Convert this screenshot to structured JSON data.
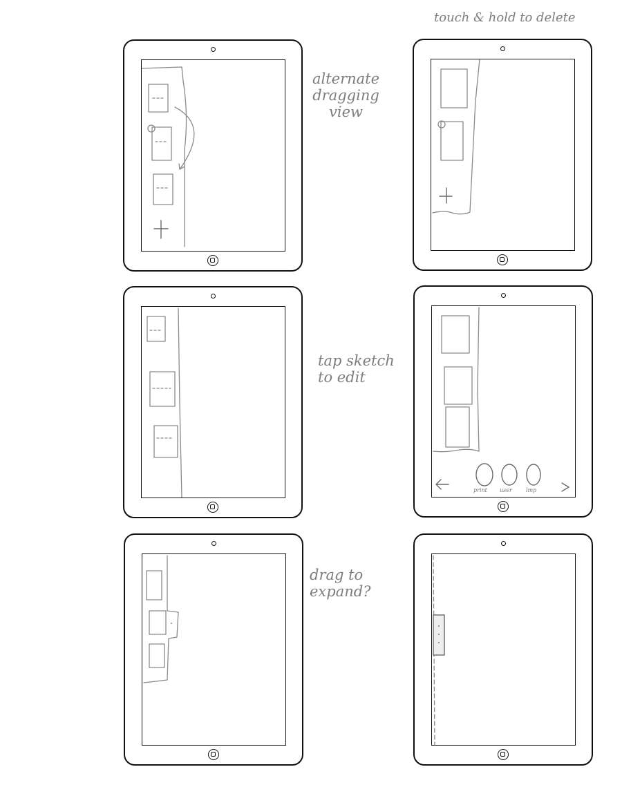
{
  "annotations": {
    "alternate": "alternate\ndragging\nview",
    "touch_hold": "touch & hold to delete",
    "tap_sketch": "tap sketch\nto edit",
    "drag_expand": "drag to\nexpand?"
  },
  "panel4_toolbar": {
    "left_arrow": "←",
    "right_arrow": "→",
    "buttons": [
      "print",
      "user",
      "lmp"
    ]
  },
  "colors": {
    "pencil": "#8a8a8a",
    "ink": "#111111"
  }
}
